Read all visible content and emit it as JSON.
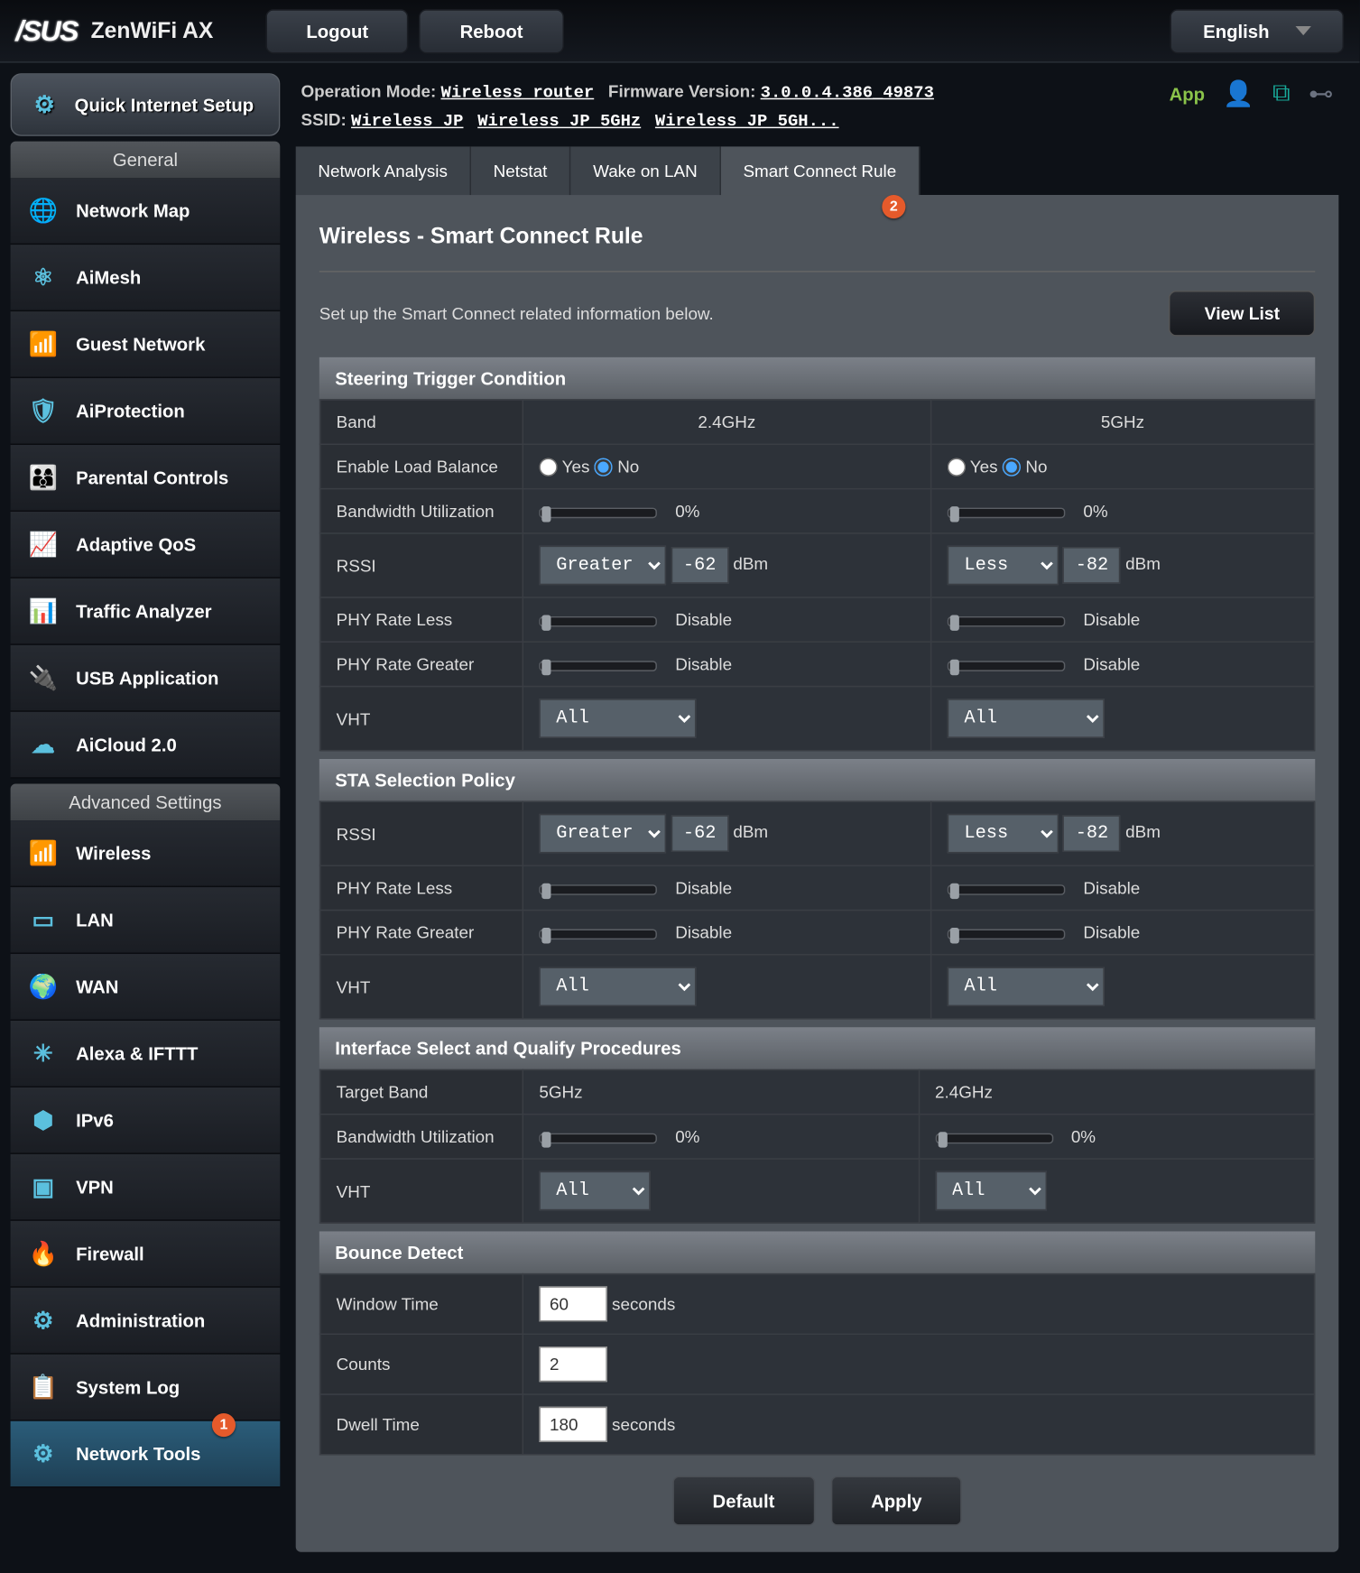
{
  "brand": "/SUS",
  "product": "ZenWiFi AX",
  "top_buttons": {
    "logout": "Logout",
    "reboot": "Reboot"
  },
  "language": "English",
  "info": {
    "op_mode_label": "Operation Mode:",
    "op_mode": "Wireless router",
    "fw_label": "Firmware Version:",
    "fw": "3.0.0.4.386_49873",
    "ssid_label": "SSID:",
    "ssid1": "Wireless JP",
    "ssid2": "Wireless JP 5GHz",
    "ssid3": "Wireless JP 5GH...",
    "app_label": "App"
  },
  "qis": "Quick Internet Setup",
  "sections": {
    "general": "General",
    "advanced": "Advanced Settings"
  },
  "menu_general": [
    "Network Map",
    "AiMesh",
    "Guest Network",
    "AiProtection",
    "Parental Controls",
    "Adaptive QoS",
    "Traffic Analyzer",
    "USB Application",
    "AiCloud 2.0"
  ],
  "menu_adv": [
    "Wireless",
    "LAN",
    "WAN",
    "Alexa & IFTTT",
    "IPv6",
    "VPN",
    "Firewall",
    "Administration",
    "System Log",
    "Network Tools"
  ],
  "badge1": "1",
  "badge2": "2",
  "tabs": [
    "Network Analysis",
    "Netstat",
    "Wake on LAN",
    "Smart Connect Rule"
  ],
  "page": {
    "title": "Wireless - Smart Connect Rule",
    "desc": "Set up the Smart Connect related information below.",
    "view_list": "View List"
  },
  "sec1": "Steering Trigger Condition",
  "sec2": "STA Selection Policy",
  "sec3": "Interface Select and Qualify Procedures",
  "sec4": "Bounce Detect",
  "labels": {
    "band": "Band",
    "elb": "Enable Load Balance",
    "bw": "Bandwidth Utilization",
    "rssi": "RSSI",
    "prl": "PHY Rate Less",
    "prg": "PHY Rate Greater",
    "vht": "VHT",
    "tband": "Target Band",
    "wtime": "Window Time",
    "counts": "Counts",
    "dwell": "Dwell Time"
  },
  "bands": {
    "b24": "2.4GHz",
    "b5": "5GHz"
  },
  "radio": {
    "yes": "Yes",
    "no": "No"
  },
  "vals": {
    "pct0": "0%",
    "greater": "Greater",
    "less": "Less",
    "n62": "-62",
    "n82": "-82",
    "dbm": "dBm",
    "disable": "Disable",
    "all": "All",
    "sec": "seconds",
    "wt": "60",
    "ct": "2",
    "dt": "180"
  },
  "buttons": {
    "default": "Default",
    "apply": "Apply"
  }
}
